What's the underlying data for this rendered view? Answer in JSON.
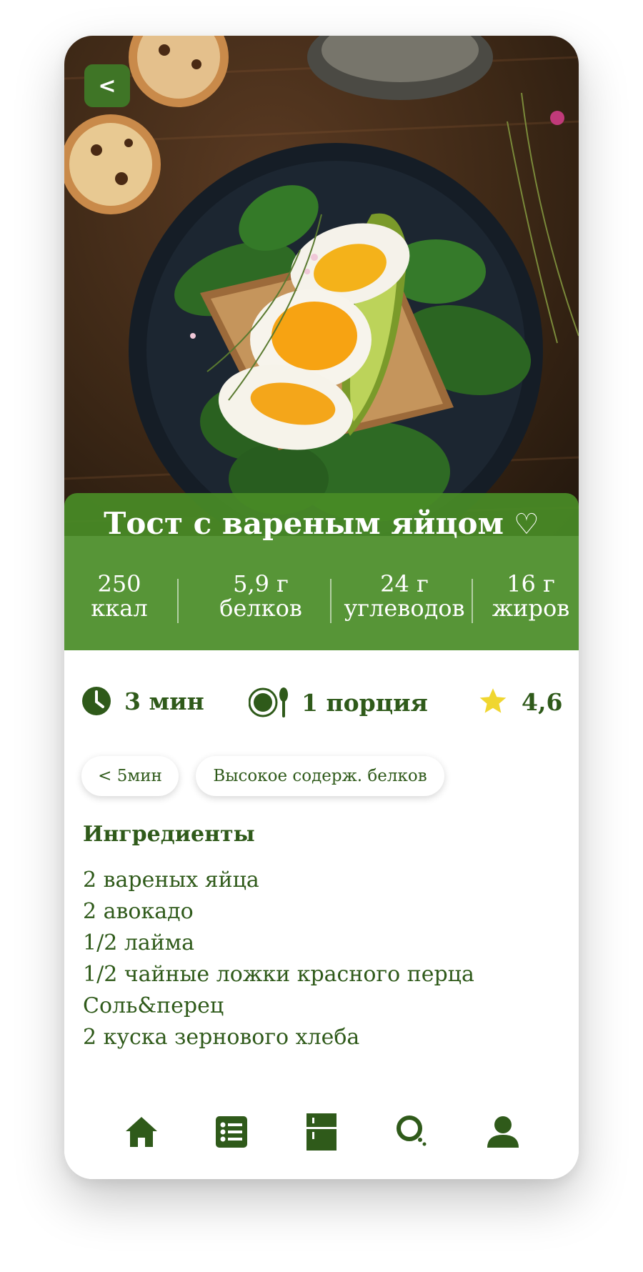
{
  "recipe": {
    "back_label": "<",
    "title": "Тост с вареным яйцом",
    "favorite_icon": "♡"
  },
  "nutrition": [
    {
      "value": "250",
      "unit": "ккал"
    },
    {
      "value": "5,9 г",
      "unit": "белков"
    },
    {
      "value": "24 г",
      "unit": "углеводов"
    },
    {
      "value": "16 г",
      "unit": "жиров"
    }
  ],
  "meta": {
    "time": "3 мин",
    "portions": "1 порция",
    "rating": "4,6"
  },
  "tags": [
    "< 5мин",
    "Высокое содерж. белков"
  ],
  "ingredients": {
    "title": "Ингредиенты",
    "items": [
      "2 вареных яйца",
      "2 авокадо",
      "1/2 лайма",
      "1/2 чайные ложки красного перца",
      "Соль&перец",
      "2 куска зернового хлеба"
    ]
  },
  "nav": {
    "icons": [
      "home-icon",
      "list-icon",
      "fridge-icon",
      "search-icon",
      "profile-icon"
    ]
  },
  "colors": {
    "primary_dark": "#2f5a1a",
    "panel_green": "#498c26",
    "button_green": "#3f7526",
    "star_yellow": "#f0d630"
  }
}
